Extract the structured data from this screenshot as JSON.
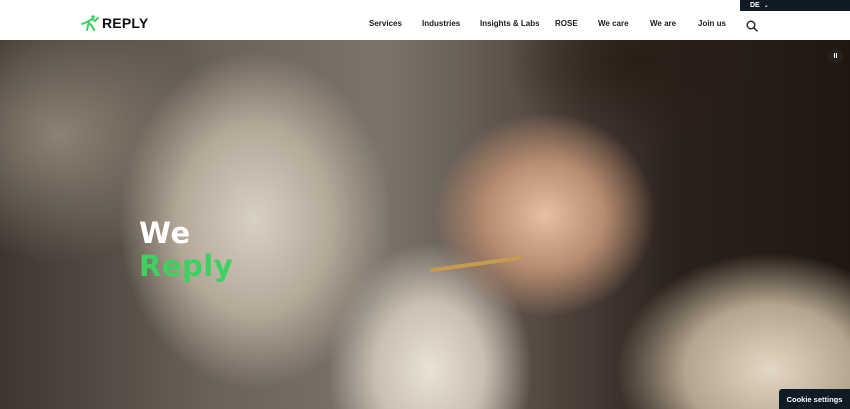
{
  "language": {
    "label": "DE"
  },
  "header": {
    "logo_text": "REPLY",
    "nav": [
      "Services",
      "Industries",
      "Insights & Labs",
      "ROSE",
      "We care",
      "We are",
      "Join us"
    ]
  },
  "hero": {
    "headline_line1": "We",
    "headline_line2": "Reply",
    "pause_label": "II"
  },
  "cookie": {
    "label": "Cookie settings"
  },
  "colors": {
    "accent": "#3dd15f",
    "dark": "#0f1c26"
  }
}
